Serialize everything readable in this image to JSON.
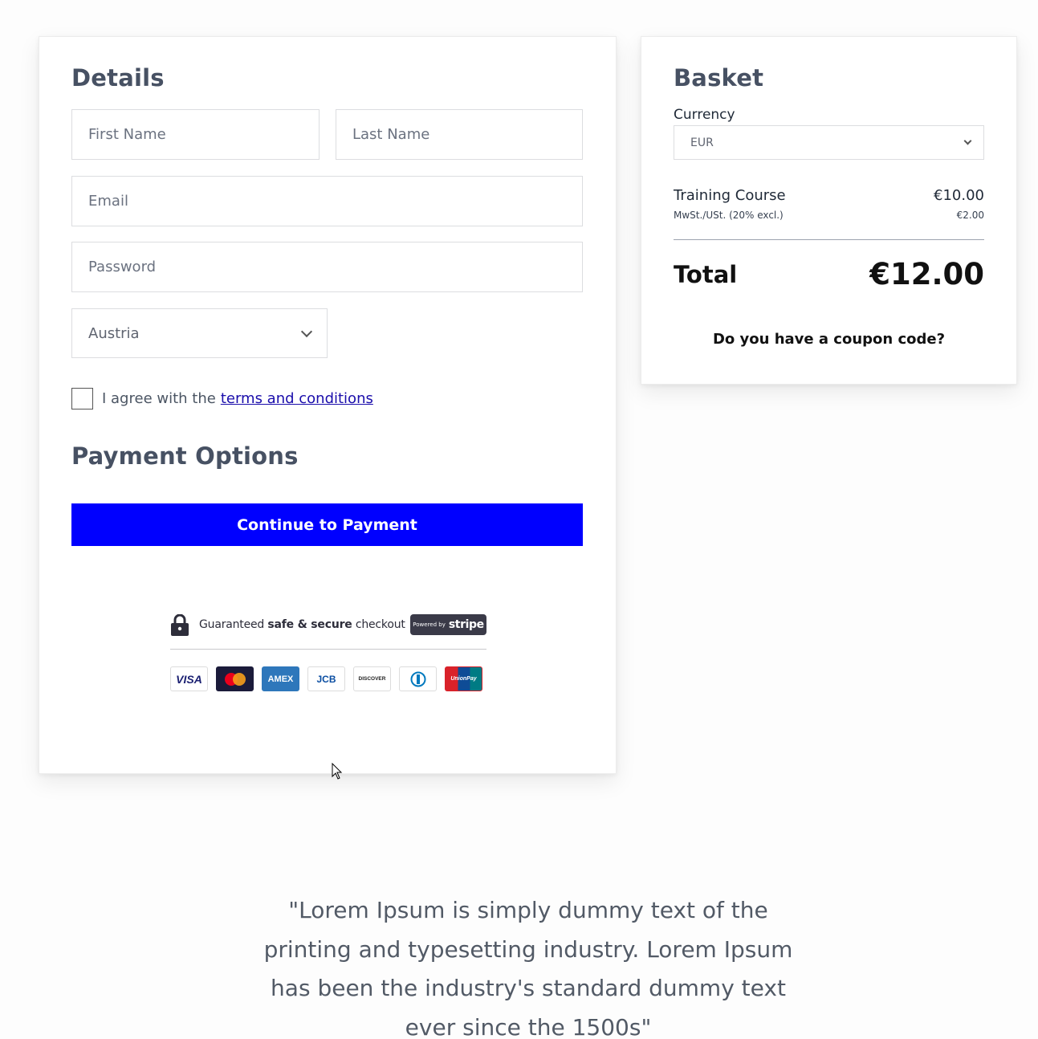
{
  "details": {
    "title": "Details",
    "first_name_placeholder": "First Name",
    "last_name_placeholder": "Last Name",
    "email_placeholder": "Email",
    "password_placeholder": "Password",
    "country_value": "Austria",
    "agree_text": "I agree with the",
    "terms_link": "terms and conditions",
    "payment_title": "Payment Options",
    "continue_label": "Continue to Payment"
  },
  "secure_badge": {
    "text_prefix": "Guaranteed ",
    "text_bold": "safe & secure",
    "text_suffix": " checkout",
    "powered_by": "Powered by",
    "stripe": "stripe",
    "icon": "lock-icon"
  },
  "payment_cards": [
    {
      "name": "visa-card-icon",
      "label": "VISA",
      "color": "#1a1f71",
      "bg": "#ffffff"
    },
    {
      "name": "mastercard-card-icon",
      "label": "",
      "color": "#ffffff",
      "bg": "#1b1b3a"
    },
    {
      "name": "amex-card-icon",
      "label": "AMEX",
      "color": "#ffffff",
      "bg": "#2e77bb"
    },
    {
      "name": "jcb-card-icon",
      "label": "JCB",
      "color": "#0b4ea2",
      "bg": "#ffffff"
    },
    {
      "name": "discover-card-icon",
      "label": "DISCOVER",
      "color": "#222222",
      "bg": "#ffffff"
    },
    {
      "name": "diners-card-icon",
      "label": "",
      "color": "#0079be",
      "bg": "#ffffff"
    },
    {
      "name": "unionpay-card-icon",
      "label": "UnionPay",
      "color": "#ffffff",
      "bg": "#d9222a"
    }
  ],
  "basket": {
    "title": "Basket",
    "currency_label": "Currency",
    "currency_value": "EUR",
    "item_name": "Training Course",
    "item_price": "€10.00",
    "tax_label": "MwSt./USt. (20% excl.)",
    "tax_value": "€2.00",
    "total_label": "Total",
    "total_value": "€12.00",
    "coupon_text": "Do you have a coupon code?"
  },
  "quote": "\"Lorem Ipsum is simply dummy text of the printing and typesetting industry. Lorem Ipsum has been the industry's standard dummy text ever since the 1500s\"",
  "colors": {
    "primary_button": "#0000ff",
    "link": "#1a0dab",
    "heading": "#475163"
  }
}
